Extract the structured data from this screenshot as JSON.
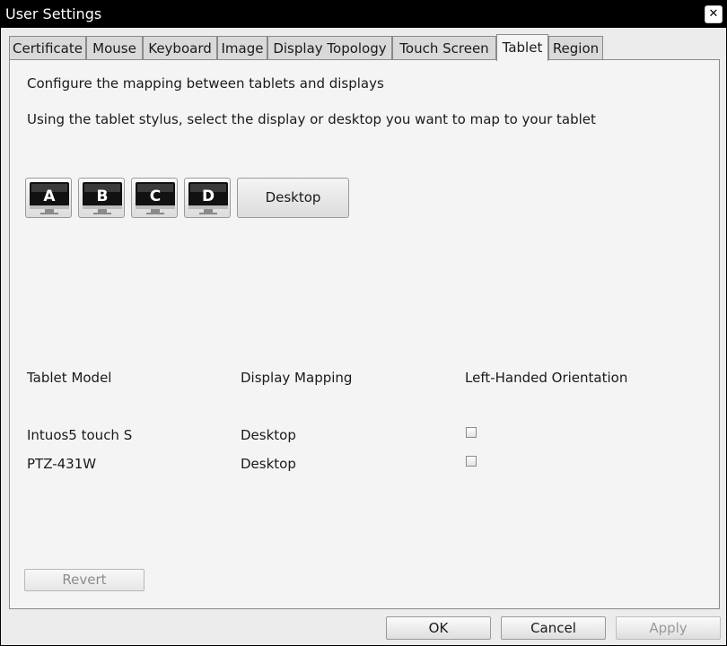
{
  "window": {
    "title": "User Settings",
    "close_glyph": "✕"
  },
  "tabs": [
    {
      "label": "Certificate"
    },
    {
      "label": "Mouse"
    },
    {
      "label": "Keyboard"
    },
    {
      "label": "Image"
    },
    {
      "label": "Display Topology"
    },
    {
      "label": "Touch Screen"
    },
    {
      "label": "Tablet",
      "active": true
    },
    {
      "label": "Region"
    }
  ],
  "tablet": {
    "heading": "Configure the mapping between tablets and displays",
    "instruction": "Using the tablet stylus, select the display or desktop you want to map to your tablet",
    "displays": [
      {
        "letter": "A",
        "icon": "monitor-icon"
      },
      {
        "letter": "B",
        "icon": "monitor-icon"
      },
      {
        "letter": "C",
        "icon": "monitor-icon"
      },
      {
        "letter": "D",
        "icon": "monitor-icon"
      }
    ],
    "desktop_button": "Desktop",
    "columns": {
      "model": "Tablet Model",
      "mapping": "Display Mapping",
      "left_handed": "Left-Handed Orientation"
    },
    "rows": [
      {
        "model": "Intuos5 touch S",
        "mapping": "Desktop",
        "left_handed": false
      },
      {
        "model": "PTZ-431W",
        "mapping": "Desktop",
        "left_handed": false
      }
    ],
    "revert_button": "Revert"
  },
  "footer": {
    "ok": "OK",
    "cancel": "Cancel",
    "apply": "Apply"
  }
}
